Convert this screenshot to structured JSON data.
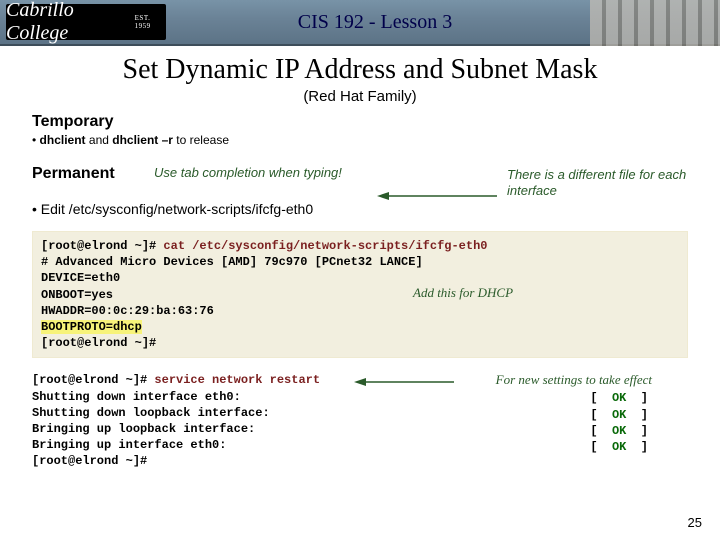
{
  "header": {
    "logo_text": "Cabrillo College",
    "logo_est": "EST. 1959",
    "lesson": "CIS 192 - Lesson 3"
  },
  "title": "Set Dynamic IP Address and Subnet Mask",
  "subtitle": "(Red Hat Family)",
  "temp": {
    "heading": "Temporary",
    "bullet_pre": "• ",
    "b1": "dhclient",
    "mid": " and ",
    "b2": "dhclient –r",
    "post": " to release"
  },
  "perm": {
    "heading": "Permanent",
    "hint": "Use tab completion when typing!",
    "bullet": "• Edit /etc/sysconfig/network-scripts/ifcfg-eth0",
    "side": "There is a different file for each interface"
  },
  "code1": {
    "prompt1": "[root@elrond ~]# ",
    "cmd1": "cat /etc/sysconfig/network-scripts/ifcfg-eth0",
    "l2": "# Advanced Micro Devices [AMD] 79c970 [PCnet32 LANCE]",
    "l3": "DEVICE=eth0",
    "l4": "ONBOOT=yes",
    "l5": "HWADDR=00:0c:29:ba:63:76",
    "l6": "BOOTPROTO=dhcp",
    "prompt2": "[root@elrond ~]#",
    "note": "Add this for DHCP"
  },
  "code2": {
    "prompt1": "[root@elrond ~]# ",
    "cmd1": "service network restart",
    "l2": "Shutting down interface eth0:",
    "l3": "Shutting down loopback interface:",
    "l4": "Bringing up loopback interface:",
    "l5": "Bringing up interface eth0:",
    "prompt2": "[root@elrond ~]#",
    "effect": "For new settings to take effect",
    "ok_open": "[",
    "ok_label": "OK",
    "ok_close": "]"
  },
  "pagenum": "25"
}
